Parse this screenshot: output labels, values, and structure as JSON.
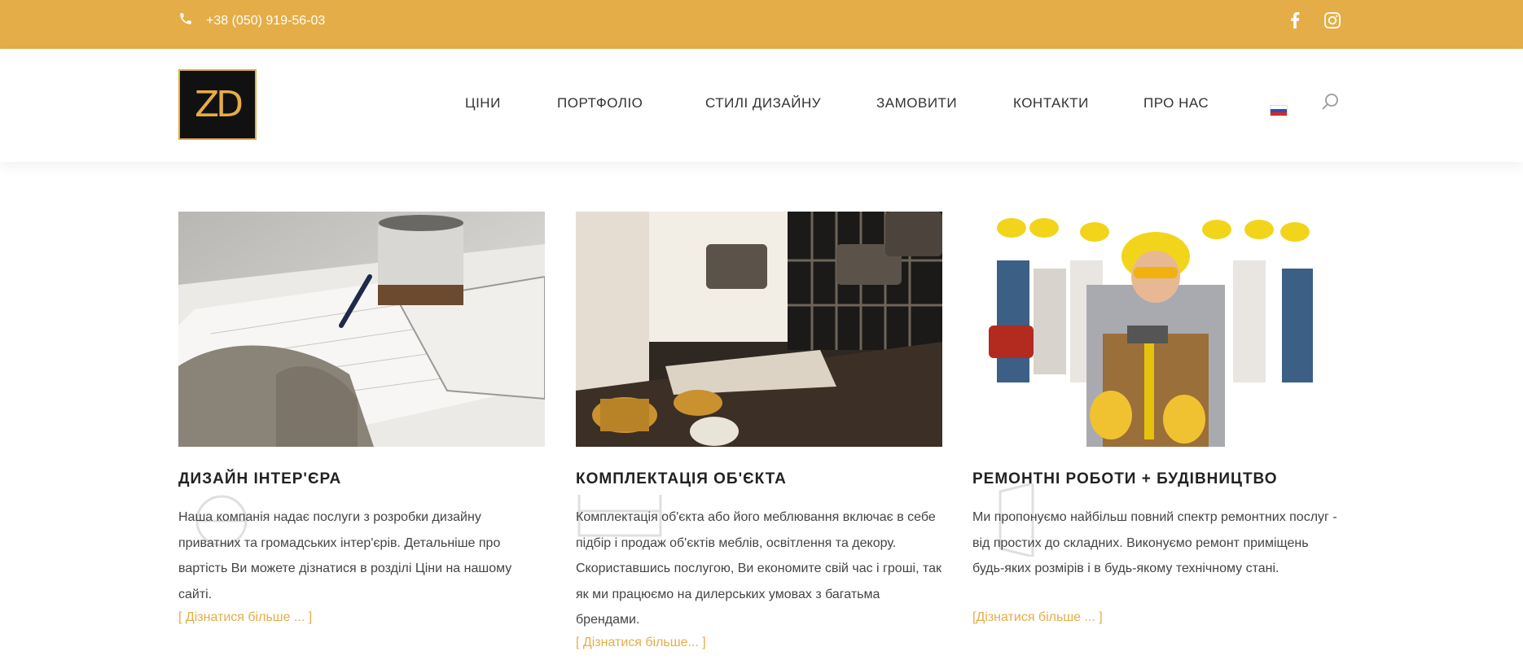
{
  "topbar": {
    "phone": "+38 (050) 919-56-03",
    "phone_icon": "phone-icon",
    "social": [
      "facebook-icon",
      "instagram-icon"
    ],
    "bg_color": "#e5ad47"
  },
  "header": {
    "logo_text": "ZD",
    "nav": [
      "ЦІНИ",
      "ПОРТФОЛІО",
      "СТИЛІ ДИЗАЙНУ",
      "ЗАМОВИТИ",
      "КОНТАКТИ",
      "ПРО НАС"
    ],
    "lang_icon": "russian-flag-icon",
    "search_icon": "search-icon"
  },
  "cards": [
    {
      "title": "ДИЗАЙН ІНТЕР'ЄРА",
      "text": "Наша компанія надає послуги з розробки дизайну приватних та громадських інтер'єрів. Детальніше про вартість Ви можете дізнатися в розділі Ціни на нашому сайті.",
      "more": "[ Дізнатися більше ... ]"
    },
    {
      "title": "КОМПЛЕКТАЦІЯ ОБ'ЄКТА",
      "text": "Комплектація об'єкта або його меблювання включає в себе підбір і продаж об'єктів меблів, освітлення та декору. Скориставшись послугою, Ви економите свій час і гроші, так як ми працюємо на дилерських умовах з багатьма брендами.",
      "more": "[ Дізнатися більше... ]"
    },
    {
      "title": "РЕМОНТНІ РОБОТИ + БУДІВНИЦТВО",
      "text": "Ми пропонуємо найбільш повний спектр ремонтних послуг - від простих до складних. Виконуємо ремонт приміщень будь-яких розмірів і в будь-якому технічному стані.",
      "more": "[Дізнатися більше ... ]"
    }
  ],
  "colors": {
    "accent": "#e5ad47",
    "text": "#444444",
    "title": "#222222"
  }
}
